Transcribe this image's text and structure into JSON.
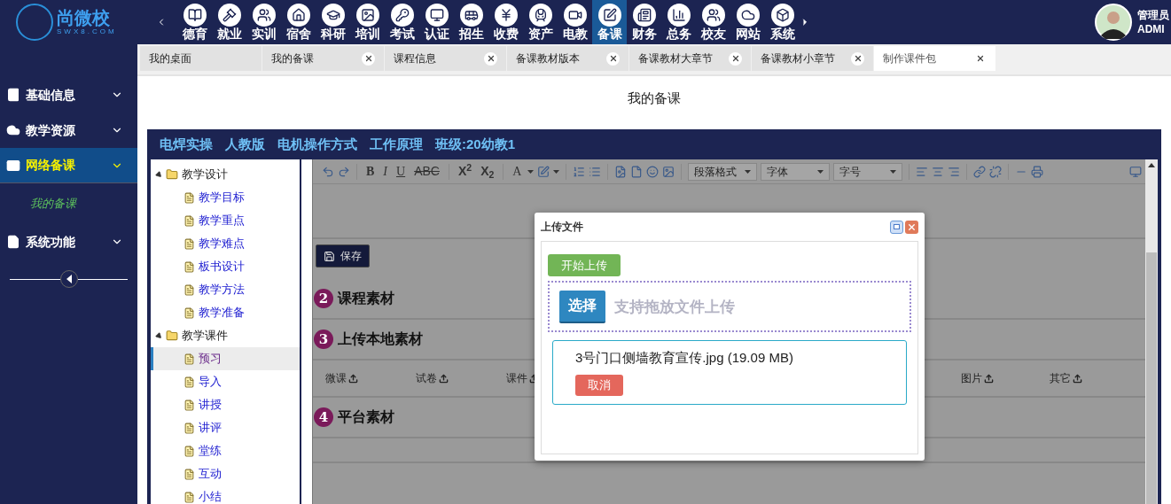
{
  "header": {
    "logo_text": "尚微校",
    "logo_sub": "SWX8.COM",
    "nav": [
      {
        "label": "德育",
        "selected": false
      },
      {
        "label": "就业",
        "selected": false
      },
      {
        "label": "实训",
        "selected": false
      },
      {
        "label": "宿舍",
        "selected": false
      },
      {
        "label": "科研",
        "selected": false
      },
      {
        "label": "培训",
        "selected": false
      },
      {
        "label": "考试",
        "selected": false
      },
      {
        "label": "认证",
        "selected": false
      },
      {
        "label": "招生",
        "selected": false
      },
      {
        "label": "收费",
        "selected": false
      },
      {
        "label": "资产",
        "selected": false
      },
      {
        "label": "电教",
        "selected": false
      },
      {
        "label": "备课",
        "selected": true
      },
      {
        "label": "财务",
        "selected": false
      },
      {
        "label": "总务",
        "selected": false
      },
      {
        "label": "校友",
        "selected": false
      },
      {
        "label": "网站",
        "selected": false
      },
      {
        "label": "系统",
        "selected": false
      }
    ],
    "user": {
      "role": "管理员",
      "name": "ADMI"
    }
  },
  "sidebar": {
    "items": [
      {
        "label": "基础信息",
        "selected": false
      },
      {
        "label": "教学资源",
        "selected": false
      },
      {
        "label": "网络备课",
        "selected": true,
        "expanded": true,
        "children": [
          {
            "label": "我的备课",
            "selected": true
          }
        ]
      },
      {
        "label": "系统功能",
        "selected": false
      }
    ]
  },
  "tabs": [
    {
      "label": "我的桌面",
      "selected": false,
      "closable": false
    },
    {
      "label": "我的备课",
      "selected": false,
      "closable": true
    },
    {
      "label": "课程信息",
      "selected": false,
      "closable": true
    },
    {
      "label": "备课教材版本",
      "selected": false,
      "closable": true
    },
    {
      "label": "备课教材大章节",
      "selected": false,
      "closable": true
    },
    {
      "label": "备课教材小章节",
      "selected": false,
      "closable": true
    },
    {
      "label": "制作课件包",
      "selected": true,
      "closable": true
    }
  ],
  "page_title": "我的备课",
  "panel": {
    "breadcrumb": [
      "电焊实操",
      "人教版",
      "电机操作方式",
      "工作原理",
      "班级:20幼教1"
    ],
    "tree": [
      {
        "label": "教学设计",
        "kind": "folder",
        "expanded": true,
        "children": [
          {
            "label": "教学目标",
            "kind": "file",
            "selected": false
          },
          {
            "label": "教学重点",
            "kind": "file",
            "selected": false
          },
          {
            "label": "教学难点",
            "kind": "file",
            "selected": false
          },
          {
            "label": "板书设计",
            "kind": "file",
            "selected": false
          },
          {
            "label": "教学方法",
            "kind": "file",
            "selected": false
          },
          {
            "label": "教学准备",
            "kind": "file",
            "selected": false
          }
        ]
      },
      {
        "label": "教学课件",
        "kind": "folder",
        "expanded": true,
        "children": [
          {
            "label": "预习",
            "kind": "file",
            "selected": true
          },
          {
            "label": "导入",
            "kind": "file",
            "selected": false
          },
          {
            "label": "讲授",
            "kind": "file",
            "selected": false
          },
          {
            "label": "讲评",
            "kind": "file",
            "selected": false
          },
          {
            "label": "堂练",
            "kind": "file",
            "selected": false
          },
          {
            "label": "互动",
            "kind": "file",
            "selected": false
          },
          {
            "label": "小结",
            "kind": "file",
            "selected": false
          }
        ]
      }
    ]
  },
  "editor": {
    "format_buttons": [
      "B",
      "I",
      "U",
      "ABC",
      "X$^{2}$",
      "X$_{2}$",
      "A"
    ],
    "selects": [
      "段落格式",
      "字体",
      "字号"
    ],
    "save_button": "保存",
    "sections": [
      {
        "number": "2",
        "title": "课程素材"
      },
      {
        "number": "3",
        "title": "上传本地素材"
      },
      {
        "number": "4",
        "title": "平台素材"
      }
    ],
    "upload_columns_left": [
      "微课",
      "试卷",
      "课件"
    ],
    "upload_columns_right": [
      "图片",
      "其它"
    ]
  },
  "dialog": {
    "title": "上传文件",
    "start_button": "开始上传",
    "choose_button": "选择",
    "drop_hint": "支持拖放文件上传",
    "file": {
      "name": "3号门口侧墙教育宣传.jpg (19.09 MB)",
      "cancel_button": "取消"
    }
  }
}
